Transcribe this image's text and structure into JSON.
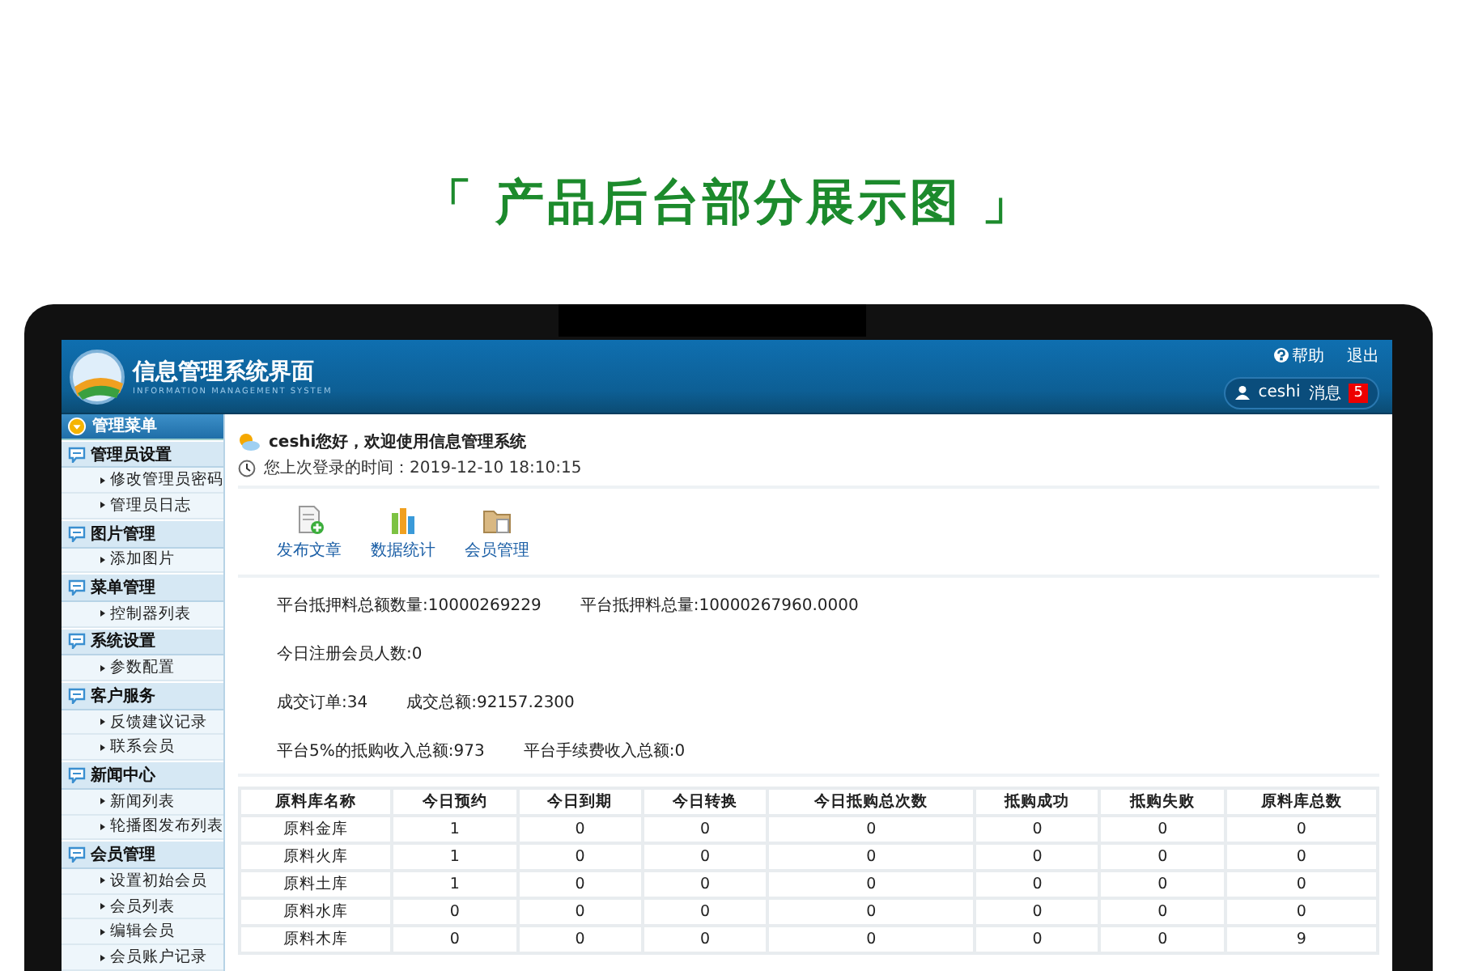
{
  "page_title": "「 产品后台部分展示图 」",
  "header": {
    "title": "信息管理系统界面",
    "subtitle": "INFORMATION MANAGEMENT SYSTEM",
    "help": "帮助",
    "logout": "退出",
    "user": "ceshi",
    "messages": "消息",
    "message_count": "5"
  },
  "sidebar": {
    "title": "管理菜单",
    "groups": [
      {
        "label": "管理员设置",
        "items": [
          "修改管理员密码",
          "管理员日志"
        ]
      },
      {
        "label": "图片管理",
        "items": [
          "添加图片"
        ]
      },
      {
        "label": "菜单管理",
        "items": [
          "控制器列表"
        ]
      },
      {
        "label": "系统设置",
        "items": [
          "参数配置"
        ]
      },
      {
        "label": "客户服务",
        "items": [
          "反馈建议记录",
          "联系会员"
        ]
      },
      {
        "label": "新闻中心",
        "items": [
          "新闻列表",
          "轮播图发布列表"
        ]
      },
      {
        "label": "会员管理",
        "items": [
          "设置初始会员",
          "会员列表",
          "编辑会员",
          "会员账户记录"
        ]
      }
    ]
  },
  "welcome": "ceshi您好，欢迎使用信息管理系统",
  "last_login": "您上次登录的时间：2019-12-10 18:10:15",
  "shortcuts": [
    {
      "label": "发布文章",
      "kind": "document"
    },
    {
      "label": "数据统计",
      "kind": "chart"
    },
    {
      "label": "会员管理",
      "kind": "folder"
    }
  ],
  "stats": [
    [
      "平台抵押料总额数量:10000269229",
      "平台抵押料总量:10000267960.0000"
    ],
    [
      "今日注册会员人数:0"
    ],
    [
      "成交订单:34",
      "成交总额:92157.2300"
    ],
    [
      "平台5%的抵购收入总额:973",
      "平台手续费收入总额:0"
    ]
  ],
  "table": {
    "columns": [
      "原料库名称",
      "今日预约",
      "今日到期",
      "今日转换",
      "今日抵购总次数",
      "抵购成功",
      "抵购失败",
      "原料库总数"
    ],
    "rows": [
      [
        "原料金库",
        "1",
        "0",
        "0",
        "0",
        "0",
        "0",
        "0"
      ],
      [
        "原料火库",
        "1",
        "0",
        "0",
        "0",
        "0",
        "0",
        "0"
      ],
      [
        "原料土库",
        "1",
        "0",
        "0",
        "0",
        "0",
        "0",
        "0"
      ],
      [
        "原料水库",
        "0",
        "0",
        "0",
        "0",
        "0",
        "0",
        "0"
      ],
      [
        "原料木库",
        "0",
        "0",
        "0",
        "0",
        "0",
        "0",
        "9"
      ]
    ]
  }
}
